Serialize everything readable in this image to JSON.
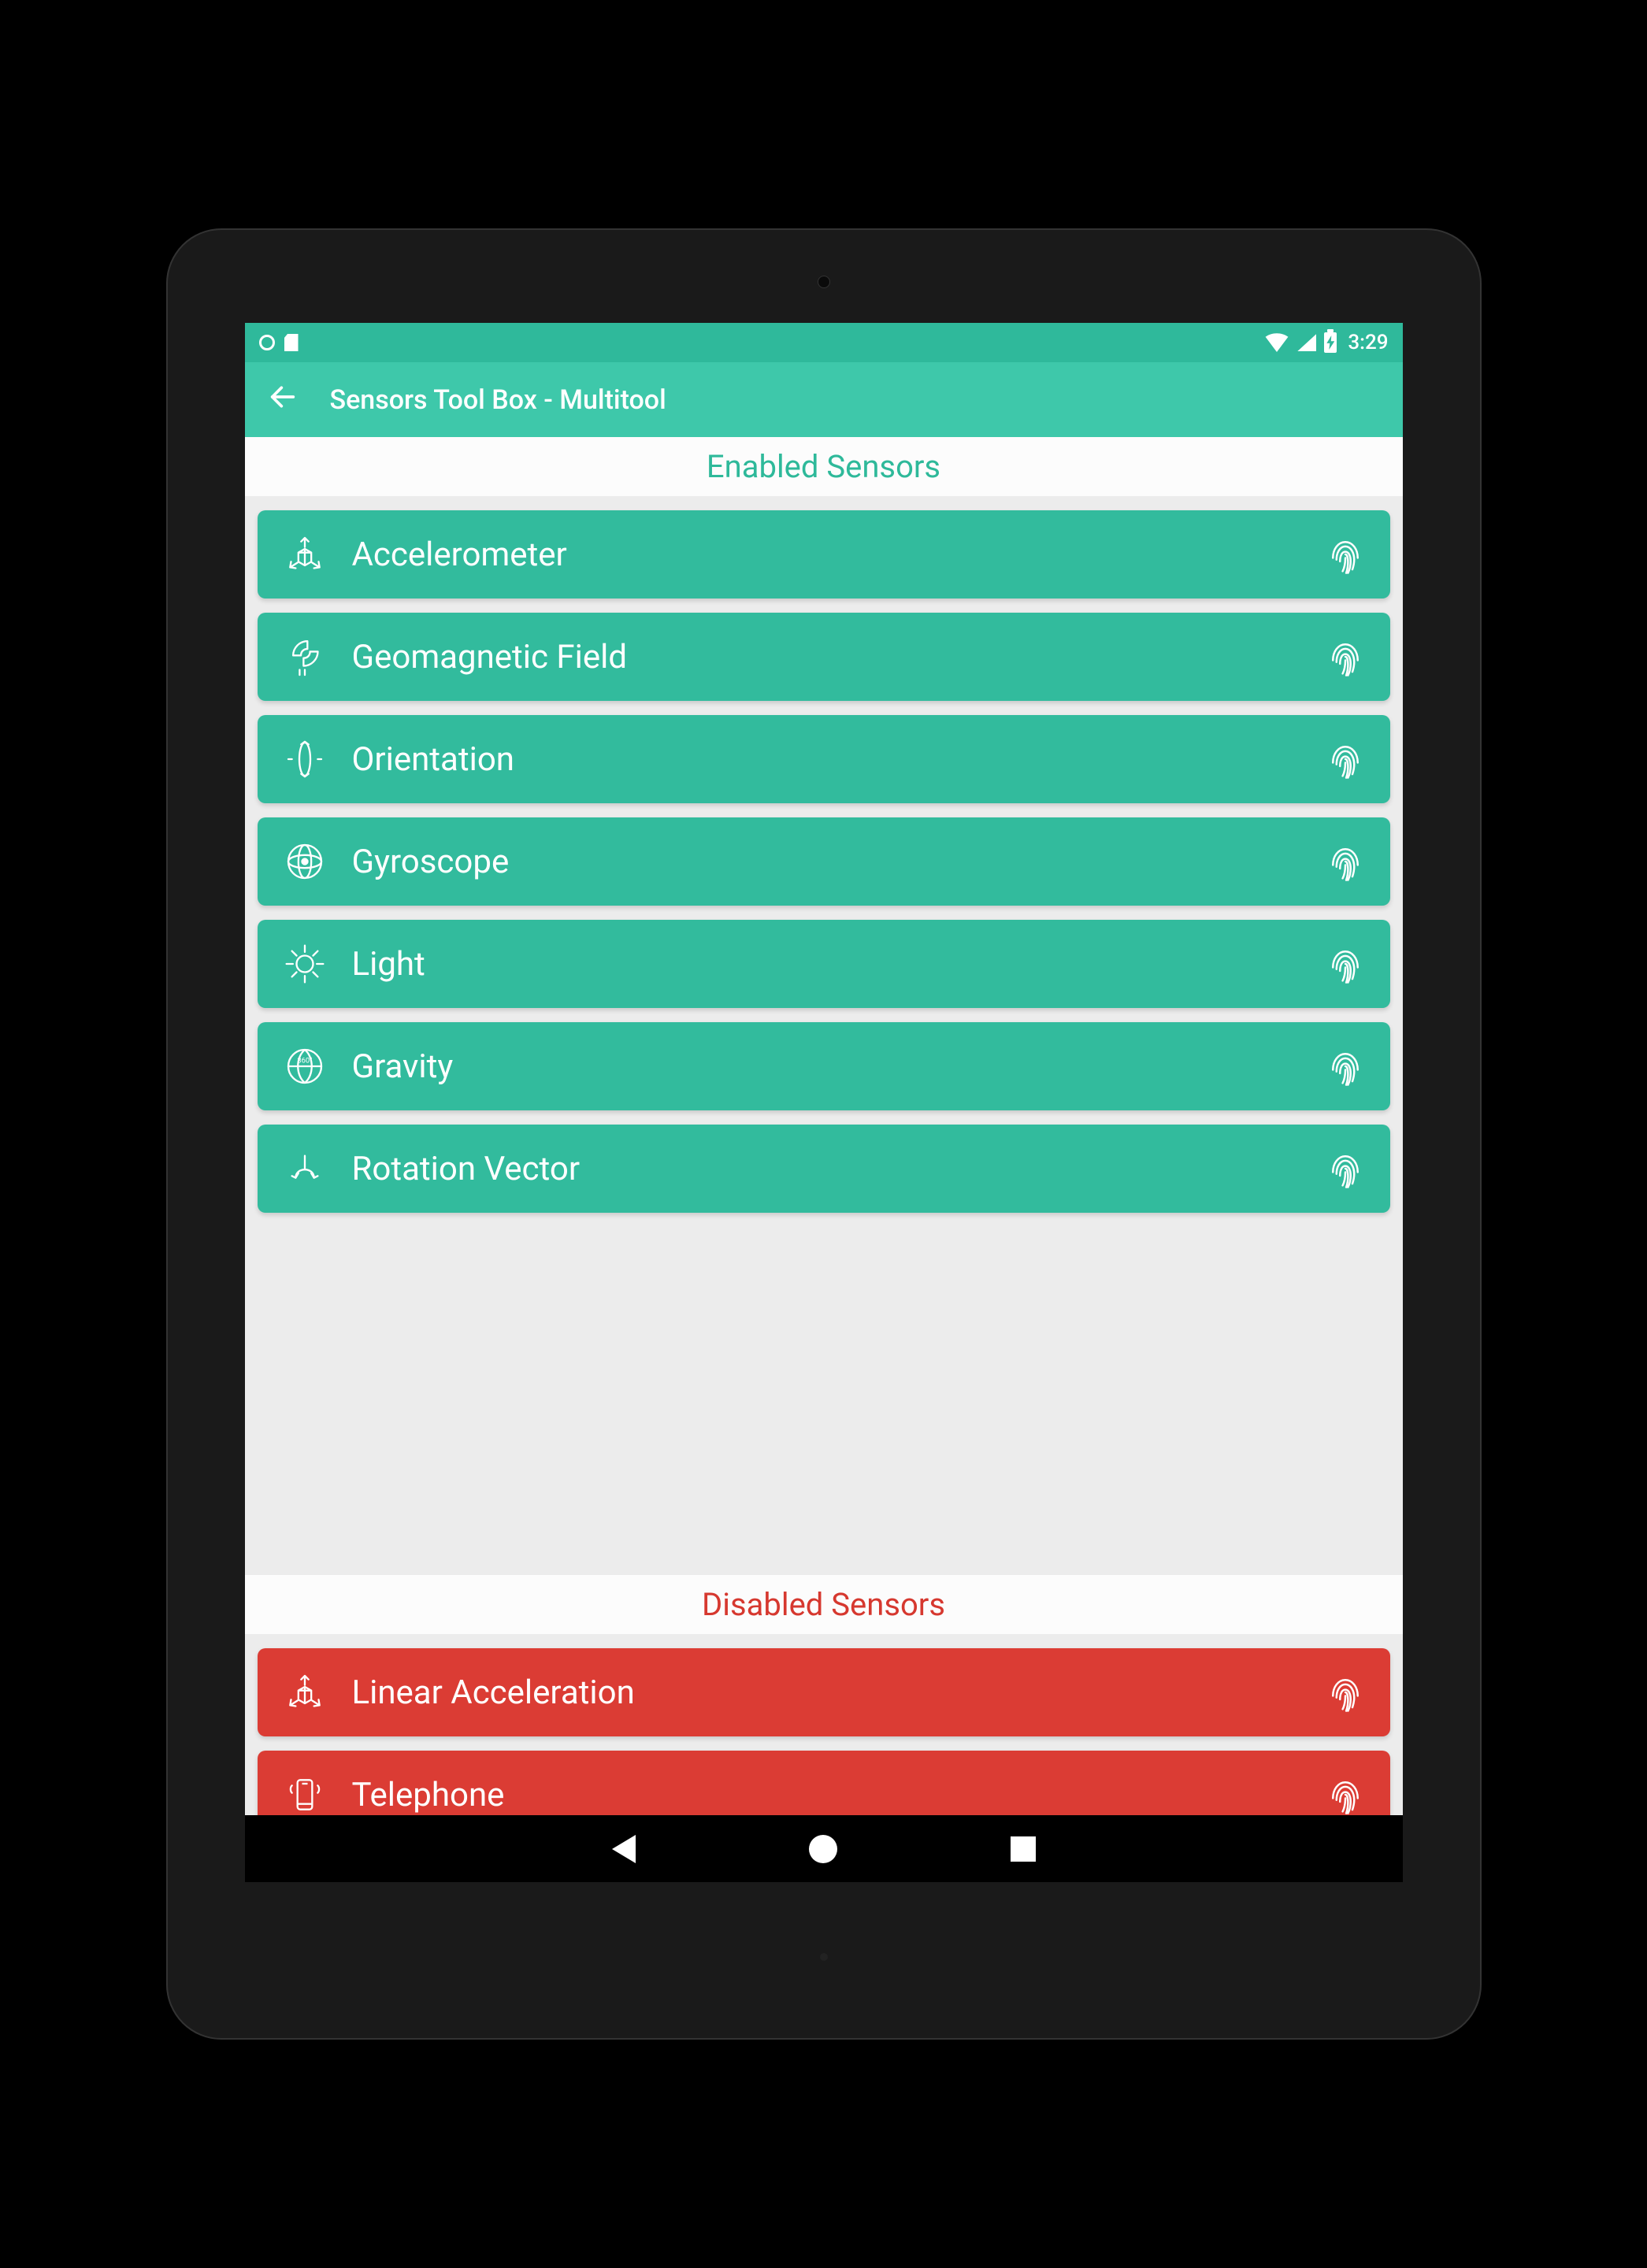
{
  "status": {
    "time": "3:29"
  },
  "appbar": {
    "title": "Sensors Tool Box - Multitool"
  },
  "sections": {
    "enabled_title": "Enabled Sensors",
    "disabled_title": "Disabled Sensors"
  },
  "enabled_sensors": [
    {
      "name": "Accelerometer",
      "icon": "accelerometer-icon"
    },
    {
      "name": "Geomagnetic Field",
      "icon": "magnet-icon"
    },
    {
      "name": "Orientation",
      "icon": "orientation-icon"
    },
    {
      "name": "Gyroscope",
      "icon": "gyroscope-icon"
    },
    {
      "name": "Light",
      "icon": "light-icon"
    },
    {
      "name": "Gravity",
      "icon": "gravity-icon"
    },
    {
      "name": "Rotation Vector",
      "icon": "rotation-icon"
    }
  ],
  "disabled_sensors": [
    {
      "name": "Linear Acceleration",
      "icon": "accelerometer-icon"
    },
    {
      "name": "Telephone",
      "icon": "telephone-icon"
    }
  ]
}
